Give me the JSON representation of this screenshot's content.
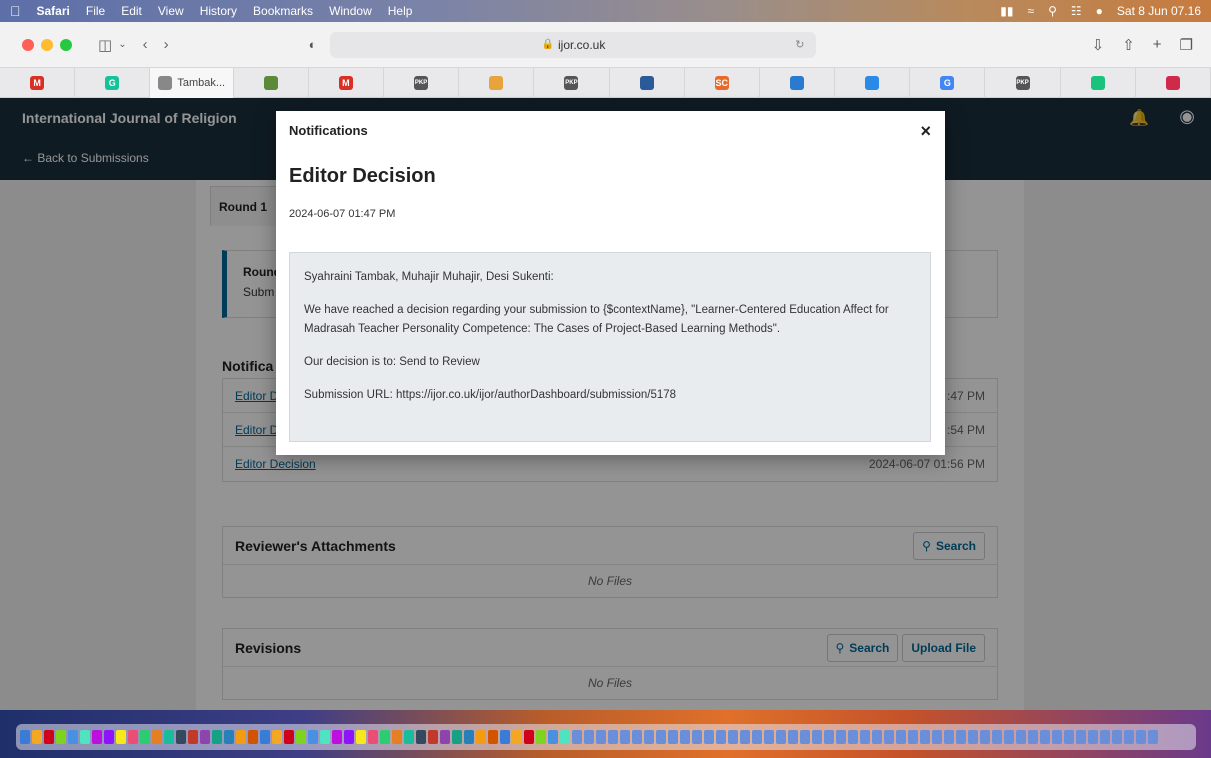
{
  "menubar": {
    "app": "Safari",
    "items": [
      "File",
      "Edit",
      "View",
      "History",
      "Bookmarks",
      "Window",
      "Help"
    ],
    "clock": "Sat 8 Jun  07.16"
  },
  "browser": {
    "url": "ijor.co.uk",
    "tabs": [
      {
        "icon": "gmail-icon",
        "label": "",
        "color": "#d93025",
        "glyph": "M"
      },
      {
        "icon": "grammarly-icon",
        "label": "",
        "color": "#15c39a",
        "glyph": "G"
      },
      {
        "icon": "page-icon",
        "label": "Tambak...",
        "color": "#888888",
        "glyph": ""
      },
      {
        "icon": "shield-icon",
        "label": "",
        "color": "#5a8a3a",
        "glyph": ""
      },
      {
        "icon": "gmail-icon",
        "label": "",
        "color": "#d93025",
        "glyph": "M"
      },
      {
        "icon": "pkp-icon",
        "label": "",
        "color": "#555555",
        "glyph": "PKP"
      },
      {
        "icon": "site-icon",
        "label": "",
        "color": "#e8a33d",
        "glyph": ""
      },
      {
        "icon": "pkp-icon",
        "label": "",
        "color": "#555555",
        "glyph": "PKP"
      },
      {
        "icon": "journal-icon",
        "label": "",
        "color": "#2a5a9a",
        "glyph": ""
      },
      {
        "icon": "sc-icon",
        "label": "",
        "color": "#e86a2a",
        "glyph": "SC"
      },
      {
        "icon": "globe-icon",
        "label": "",
        "color": "#2a7ad0",
        "glyph": ""
      },
      {
        "icon": "diamond-icon",
        "label": "",
        "color": "#2a8ae8",
        "glyph": ""
      },
      {
        "icon": "google-icon",
        "label": "",
        "color": "#4285f4",
        "glyph": "G"
      },
      {
        "icon": "pkp-icon",
        "label": "",
        "color": "#555555",
        "glyph": "PKP"
      },
      {
        "icon": "chatgpt-icon",
        "label": "",
        "color": "#19c37d",
        "glyph": ""
      },
      {
        "icon": "bookmark-icon",
        "label": "",
        "color": "#d02a4a",
        "glyph": ""
      }
    ]
  },
  "ojs": {
    "journal_title": "International Journal of Religion",
    "back_link": "← Back to Submissions",
    "round_tab": "Round 1",
    "round_panel": {
      "title": "Round",
      "subtitle": "Subm"
    },
    "notifications_heading": "Notifica",
    "notifications": [
      {
        "label": "Editor D",
        "date": ":47 PM"
      },
      {
        "label": "Editor D",
        "date": ":54 PM"
      },
      {
        "label": "Editor Decision",
        "date": "2024-06-07 01:56 PM"
      }
    ],
    "reviewer_attachments": {
      "title": "Reviewer's Attachments",
      "search": "Search",
      "empty": "No Files"
    },
    "revisions": {
      "title": "Revisions",
      "search": "Search",
      "upload": "Upload File",
      "empty": "No Files"
    }
  },
  "modal": {
    "title": "Notifications",
    "close": "×",
    "heading": "Editor Decision",
    "date": "2024-06-07 01:47 PM",
    "body": {
      "greeting": "Syahraini Tambak, Muhajir Muhajir, Desi Sukenti:",
      "p1": "We have reached a decision regarding your submission to {$contextName}, \"Learner-Centered Education Affect for Madrasah Teacher Personality Competence: The Cases of Project-Based Learning Methods\".",
      "p2": "Our decision is to: Send to Review",
      "p3": "Submission URL: https://ijor.co.uk/ijor/authorDashboard/submission/5178"
    }
  },
  "colors": {
    "ojs_header": "#1b2f3d",
    "link": "#006798"
  }
}
